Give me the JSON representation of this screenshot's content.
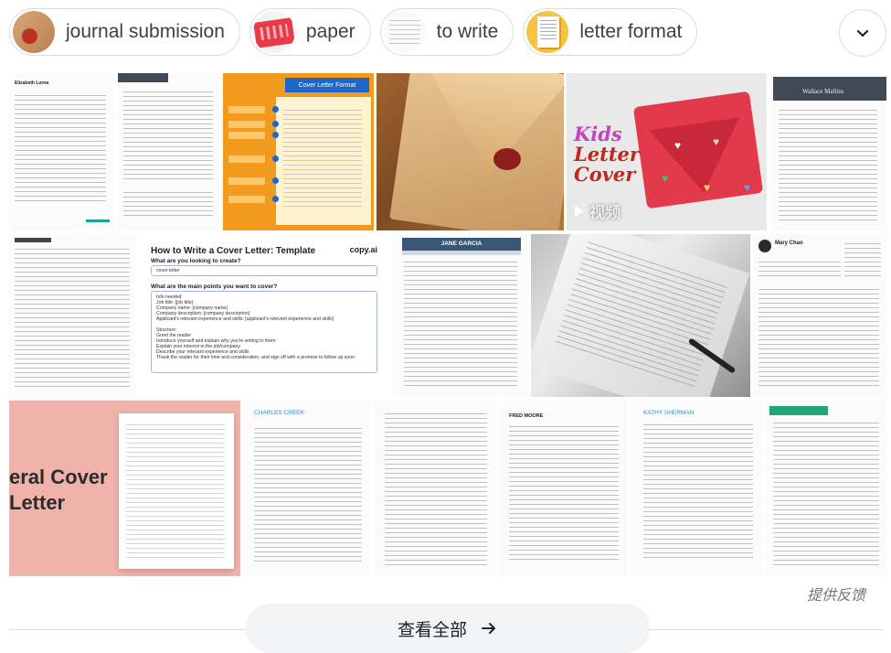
{
  "chips": [
    {
      "label": "journal submission",
      "thumb_icon": "red-seal-thumbnail"
    },
    {
      "label": "paper",
      "thumb_icon": "red-envelope-thumbnail"
    },
    {
      "label": "to write",
      "thumb_icon": "handwritten-page-thumbnail"
    },
    {
      "label": "letter format",
      "thumb_icon": "letter-document-thumbnail"
    }
  ],
  "expand_icon": "chevron-down-icon",
  "tiles": {
    "t1": {
      "name": "Elizabeth Lorna"
    },
    "t3": {
      "header": "Cover Letter Format"
    },
    "t5": {
      "line1": "Kids",
      "line2": "Letter",
      "line3": "Cover",
      "badge": "视频"
    },
    "t6": {
      "name": "Wallace Mallins"
    },
    "t7": {
      "title": "How to Write a Cover Letter: Template",
      "brand": "copy.ai",
      "q1": "What are you looking to create?",
      "a1": "cover letter",
      "q2": "What are the main points you want to cover?",
      "lines": [
        "Info needed:",
        "Job title: [job title]",
        "Company name: [company name]",
        "Company description: [company description]",
        "Applicant's relevant experience and skills: [applicant's relevant experience and skills]",
        "",
        "Structure:",
        "Greet the reader",
        "Introduce yourself and explain why you're writing to them",
        "Explain your interest in the job/company",
        "Describe your relevant experience and skills",
        "Thank the reader for their time and consideration, and sign off with a promise to follow up soon"
      ]
    },
    "t8": {
      "name": "JANE GARCIA"
    },
    "t10": {
      "name": "Mary Chao"
    },
    "t11": {
      "big1": "eral Cover",
      "big2": "Letter"
    },
    "t12": {
      "name": "CHARLES CREEK"
    },
    "t14": {
      "name": "FRED MOORE"
    },
    "t15": {
      "name": "KATHY SHERMAN"
    }
  },
  "feedback": "提供反馈",
  "see_all": {
    "label": "查看全部",
    "icon": "arrow-right-icon"
  },
  "colors": {
    "orange": "#f29a1d",
    "blue": "#1d67c9",
    "pink": "#f0b3ab",
    "red": "#e23a4a"
  }
}
